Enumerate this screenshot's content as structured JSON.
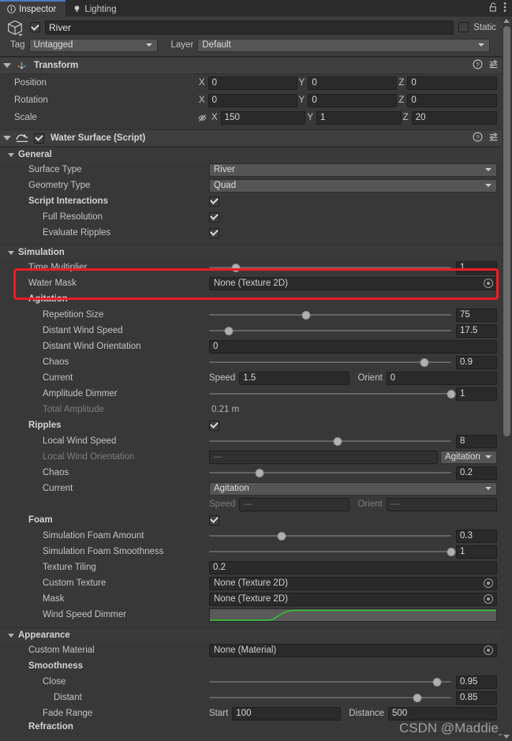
{
  "tabs": [
    {
      "label": "Inspector",
      "icon": "info-icon",
      "active": true
    },
    {
      "label": "Lighting",
      "icon": "bulb-icon",
      "active": false
    }
  ],
  "window_tools": {
    "lock_icon": "lock-open-icon",
    "menu_icon": "kebab-menu-icon"
  },
  "gameobject": {
    "enabled": true,
    "name": "River",
    "static_label": "Static",
    "static_checked": false,
    "tag_label": "Tag",
    "tag_value": "Untagged",
    "layer_label": "Layer",
    "layer_value": "Default"
  },
  "transform": {
    "title": "Transform",
    "icon": "transform-axis-icon",
    "help_icon": "help-icon",
    "preset_icon": "preset-icon",
    "menu_icon": "kebab-menu-icon",
    "rows": [
      {
        "label": "Position",
        "x": "0",
        "y": "0",
        "z": "0",
        "hidden_icon": false
      },
      {
        "label": "Rotation",
        "x": "0",
        "y": "0",
        "z": "0",
        "hidden_icon": false
      },
      {
        "label": "Scale",
        "x": "150",
        "y": "1",
        "z": "20",
        "hidden_icon": true
      }
    ],
    "axis_labels": {
      "x": "X",
      "y": "Y",
      "z": "Z"
    }
  },
  "water_surface": {
    "title": "Water Surface (Script)",
    "icon": "water-script-icon",
    "enabled": true,
    "help_icon": "help-icon",
    "preset_icon": "preset-icon",
    "menu_icon": "kebab-menu-icon"
  },
  "general": {
    "title": "General",
    "surface_type": {
      "label": "Surface Type",
      "value": "River"
    },
    "geometry_type": {
      "label": "Geometry Type",
      "value": "Quad"
    },
    "script_interactions": {
      "label": "Script Interactions",
      "checked": true
    },
    "full_resolution": {
      "label": "Full Resolution",
      "checked": true
    },
    "evaluate_ripples": {
      "label": "Evaluate Ripples",
      "checked": true
    }
  },
  "simulation": {
    "title": "Simulation",
    "time_multiplier": {
      "label": "Time Multiplier",
      "value": "1",
      "knob_pct": 11
    },
    "water_mask": {
      "label": "Water Mask",
      "value": "None (Texture 2D)"
    },
    "agitation": {
      "title": "Agitation",
      "repetition_size": {
        "label": "Repetition Size",
        "value": "75",
        "knob_pct": 40
      },
      "distant_wind_speed": {
        "label": "Distant Wind Speed",
        "value": "17.5",
        "knob_pct": 8
      },
      "distant_wind_orientation": {
        "label": "Distant Wind Orientation",
        "value": "0"
      },
      "chaos": {
        "label": "Chaos",
        "value": "0.9",
        "knob_pct": 89
      },
      "current": {
        "label": "Current",
        "speed_label": "Speed",
        "speed_value": "1.5",
        "orient_label": "Orient",
        "orient_value": "0"
      },
      "amplitude_dimmer": {
        "label": "Amplitude Dimmer",
        "value": "1",
        "knob_pct": 100
      },
      "total_amplitude": {
        "label": "Total Amplitude",
        "value": "0.21 m"
      }
    },
    "ripples": {
      "title": "Ripples",
      "checked": true,
      "local_wind_speed": {
        "label": "Local Wind Speed",
        "value": "8",
        "knob_pct": 53
      },
      "local_wind_orientation": {
        "label": "Local Wind Orientation",
        "value": "—",
        "mode": "Agitation"
      },
      "chaos": {
        "label": "Chaos",
        "value": "0.2",
        "knob_pct": 21
      },
      "current": {
        "label": "Current",
        "value": "Agitation",
        "speed_label": "Speed",
        "speed_value": "—",
        "orient_label": "Orient",
        "orient_value": "—"
      }
    },
    "foam": {
      "title": "Foam",
      "checked": true,
      "simulation_foam_amount": {
        "label": "Simulation Foam Amount",
        "value": "0.3",
        "knob_pct": 30
      },
      "simulation_foam_smoothness": {
        "label": "Simulation Foam Smoothness",
        "value": "1",
        "knob_pct": 100
      },
      "texture_tiling": {
        "label": "Texture Tiling",
        "value": "0.2"
      },
      "custom_texture": {
        "label": "Custom Texture",
        "value": "None (Texture 2D)"
      },
      "mask": {
        "label": "Mask",
        "value": "None (Texture 2D)"
      },
      "wind_speed_dimmer": {
        "label": "Wind Speed Dimmer",
        "curve_color": "#2fc92f"
      }
    }
  },
  "appearance": {
    "title": "Appearance",
    "custom_material": {
      "label": "Custom Material",
      "value": "None (Material)"
    },
    "smoothness": {
      "title": "Smoothness",
      "close": {
        "label": "Close",
        "value": "0.95",
        "knob_pct": 94
      },
      "distant": {
        "label": "Distant",
        "value": "0.85",
        "knob_pct": 86
      }
    },
    "fade_range": {
      "label": "Fade Range",
      "start_label": "Start",
      "start_value": "100",
      "distance_label": "Distance",
      "distance_value": "500"
    },
    "refraction": {
      "title": "Refraction"
    }
  },
  "annotation": {
    "color": "#ee1c25"
  },
  "watermark": {
    "text": "CSDN @Maddie_Mo"
  },
  "scrollbar": {
    "up_icon": "scroll-up-arrow",
    "down_icon": "scroll-down-arrow"
  }
}
